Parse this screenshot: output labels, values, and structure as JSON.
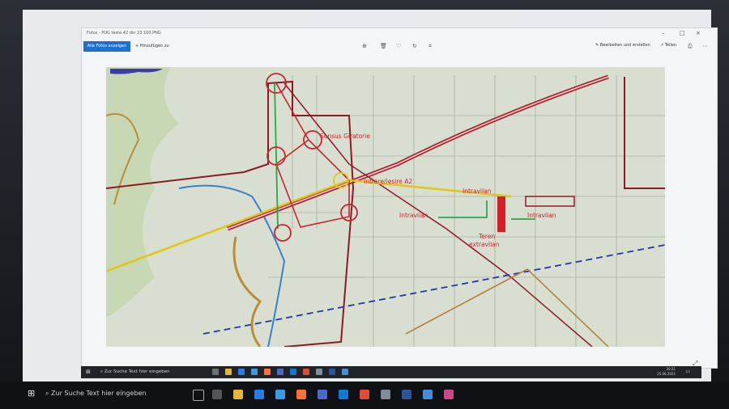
{
  "window": {
    "title": "Fotos - PUG teste.42 din 23 100.PNG",
    "controls": {
      "minimize": "–",
      "maximize": "□",
      "close": "×"
    }
  },
  "toolbar": {
    "all_photos_label": "Alle Fotos anzeigen",
    "add_label": "+ Hinzufügen zu",
    "edit_label": "Bearbeiten und erstellen",
    "share_label": "Teilen"
  },
  "icons": {
    "zoom": "zoom-icon",
    "delete": "delete-icon",
    "favorite": "heart-icon",
    "rotate": "rotate-icon",
    "crop": "crop-icon",
    "print": "print-icon",
    "more": "more-icon"
  },
  "map": {
    "labels": {
      "sensus": "Sensus Giratorie",
      "intrare": "Intrare/iesire A2",
      "intravilan_1": "Intravilan",
      "intravilan_2": "Intravilan",
      "intravilan_3": "Intravilan",
      "teren_line1": "Teren",
      "teren_line2": "extravilan"
    },
    "colors": {
      "road_red": "#c42631",
      "highway_red": "#b01f2d",
      "yellow": "#e1c61a",
      "green": "#2da44e",
      "blue_dashed": "#2536a8",
      "water": "#3a63c9",
      "parcel_bg": "#cfd8c1"
    }
  },
  "taskbar_inner": {
    "search_placeholder": "Zur Suche Text hier eingeben",
    "time": "20:21",
    "date": "25.06.2021"
  },
  "taskbar_outer": {
    "search_placeholder": "Zur Suche Text hier eingeben"
  }
}
